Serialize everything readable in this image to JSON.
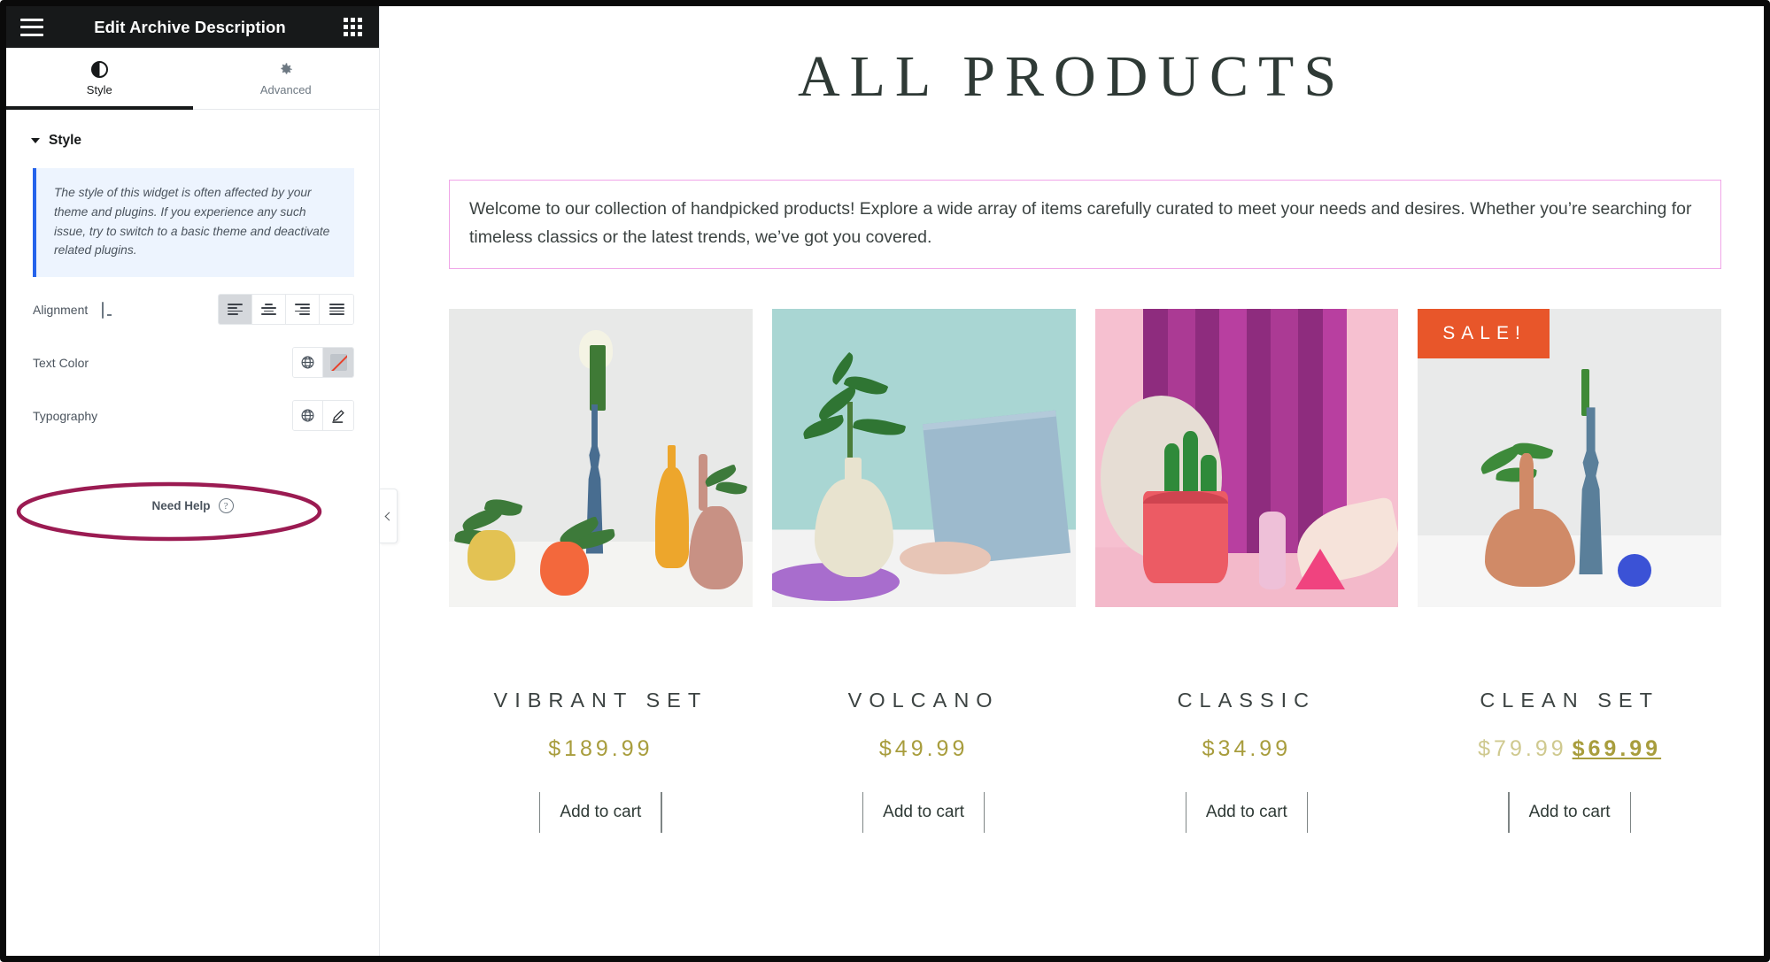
{
  "panel": {
    "header": {
      "title": "Edit Archive Description",
      "menu_icon": "hamburger-icon",
      "apps_icon": "grid-icon"
    },
    "tabs": [
      {
        "label": "Style",
        "icon": "contrast-icon",
        "active": true
      },
      {
        "label": "Advanced",
        "icon": "gear-icon",
        "active": false
      }
    ],
    "section": {
      "title": "Style",
      "expanded": true
    },
    "notice": "The style of this widget is often affected by your theme and plugins. If you experience any such issue, try to switch to a basic theme and deactivate related plugins.",
    "controls": [
      {
        "label": "Alignment",
        "device_icon": "monitor-icon",
        "options": [
          "Align left",
          "Align center",
          "Align right",
          "Justify"
        ],
        "selected": "Align left"
      },
      {
        "label": "Text Color",
        "buttons": [
          "globe-icon",
          "no-color-swatch"
        ]
      },
      {
        "label": "Typography",
        "buttons": [
          "globe-icon",
          "pencil-icon"
        ]
      }
    ],
    "need_help": {
      "label": "Need Help",
      "icon": "question-icon"
    },
    "collapse": {
      "icon": "chevron-left-icon"
    },
    "annotation": {
      "shape": "ellipse",
      "color": "#9b1b52",
      "target": "Alignment"
    }
  },
  "preview": {
    "page_title": "ALL PRODUCTS",
    "archive_description": "Welcome to our collection of handpicked products! Explore a wide array of items carefully curated to meet your needs and desires. Whether you’re searching for timeless classics or the latest trends, we’ve got you covered.",
    "selection_outline_color": "#f0a6e8",
    "products": [
      {
        "name": "VIBRANT SET",
        "price": "$189.99",
        "sale": false,
        "badge": "",
        "add_to_cart": "Add to cart",
        "scene": "vibrant-vases"
      },
      {
        "name": "VOLCANO",
        "price": "$49.99",
        "sale": false,
        "badge": "",
        "add_to_cart": "Add to cart",
        "scene": "cream-vase-teal"
      },
      {
        "name": "CLASSIC",
        "price": "$34.99",
        "sale": false,
        "badge": "",
        "add_to_cart": "Add to cart",
        "scene": "pink-cactus"
      },
      {
        "name": "CLEAN SET",
        "price_old": "$79.99",
        "price_new": "$69.99",
        "sale": true,
        "badge": "SALE!",
        "add_to_cart": "Add to cart",
        "scene": "clean-vases"
      }
    ],
    "colors": {
      "price": "#a89d3d",
      "price_old": "#cfc98f",
      "sale_badge_bg": "#e8562a",
      "title": "#2f3a36"
    }
  }
}
